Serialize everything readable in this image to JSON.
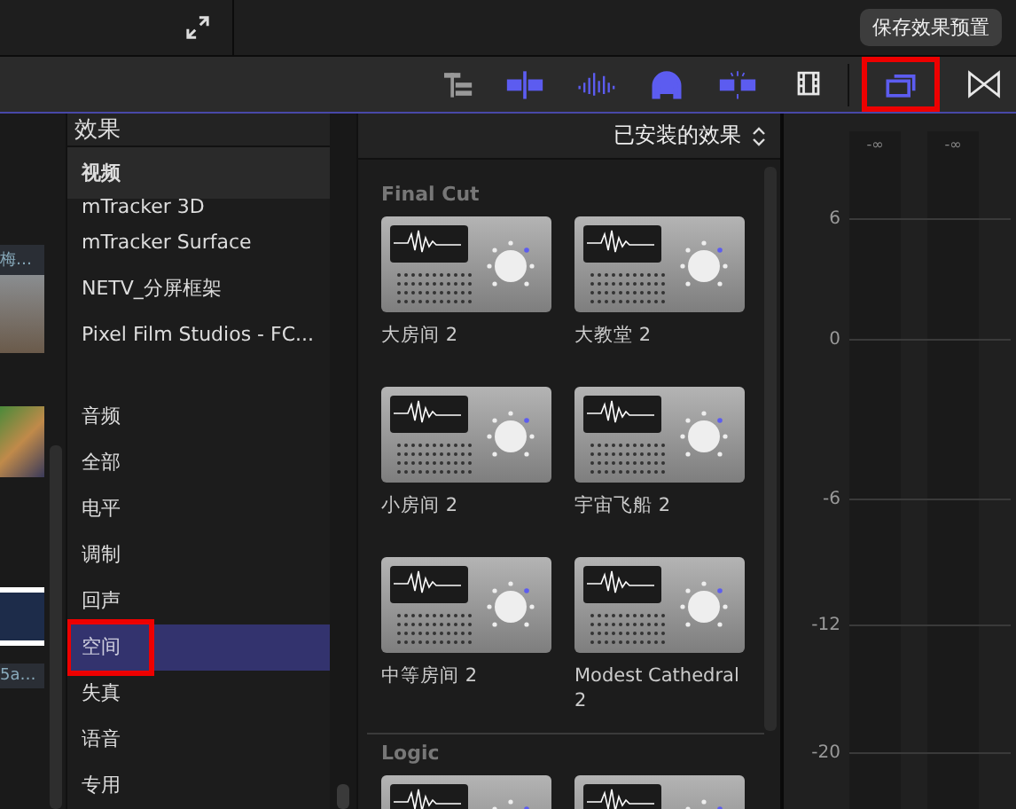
{
  "top_bar": {
    "save_button": "保存效果预置"
  },
  "toolbar": {
    "icons": [
      {
        "kind": "tracks",
        "on": false,
        "highlighted": false
      },
      {
        "kind": "split",
        "on": true,
        "highlighted": false
      },
      {
        "kind": "waveform",
        "on": true,
        "highlighted": false
      },
      {
        "kind": "headphones",
        "on": true,
        "highlighted": false
      },
      {
        "kind": "solo",
        "on": true,
        "highlighted": false
      },
      {
        "kind": "film",
        "on": false,
        "highlighted": false
      },
      {
        "kind": "windows",
        "on": true,
        "highlighted": true
      },
      {
        "kind": "transition",
        "on": false,
        "highlighted": false
      }
    ]
  },
  "browser_clips": [
    {
      "label": "梅…"
    },
    {
      "label": "5a…"
    }
  ],
  "sidebar": {
    "title": "效果",
    "section": "视频",
    "items": [
      {
        "label": "mTracker 3D",
        "selected": false,
        "highlighted": false
      },
      {
        "label": "mTracker Surface",
        "selected": false,
        "highlighted": false
      },
      {
        "label": "NETV_分屏框架",
        "selected": false,
        "highlighted": false
      },
      {
        "label": "Pixel Film Studios - FC...",
        "selected": false,
        "highlighted": false
      },
      {
        "label": "音频",
        "selected": false,
        "highlighted": false,
        "kind": "gap"
      },
      {
        "label": "全部",
        "selected": false,
        "highlighted": false
      },
      {
        "label": "电平",
        "selected": false,
        "highlighted": false
      },
      {
        "label": "调制",
        "selected": false,
        "highlighted": false
      },
      {
        "label": "回声",
        "selected": false,
        "highlighted": false
      },
      {
        "label": "空间",
        "selected": true,
        "highlighted": true
      },
      {
        "label": "失真",
        "selected": false,
        "highlighted": false
      },
      {
        "label": "语音",
        "selected": false,
        "highlighted": false
      },
      {
        "label": "专用",
        "selected": false,
        "highlighted": false
      }
    ]
  },
  "effects": {
    "filter": "已安装的效果",
    "groups": [
      {
        "title": "Final Cut",
        "items": [
          {
            "kind": "unit",
            "label": "大房间 2"
          },
          {
            "kind": "unit",
            "label": "大教堂 2"
          },
          {
            "kind": "unit",
            "label": "小房间 2"
          },
          {
            "kind": "unit",
            "label": "宇宙飞船 2"
          },
          {
            "kind": "unit",
            "label": "中等房间 2"
          },
          {
            "kind": "unit",
            "label": "Modest Cathedral 2"
          }
        ]
      },
      {
        "title": "Logic",
        "items": [
          {
            "kind": "unit"
          },
          {
            "kind": "unit"
          }
        ]
      }
    ]
  },
  "meter": {
    "peaks": [
      "-∞",
      "-∞"
    ],
    "scale": [
      "6",
      "0",
      "-6",
      "-12",
      "-20"
    ]
  }
}
